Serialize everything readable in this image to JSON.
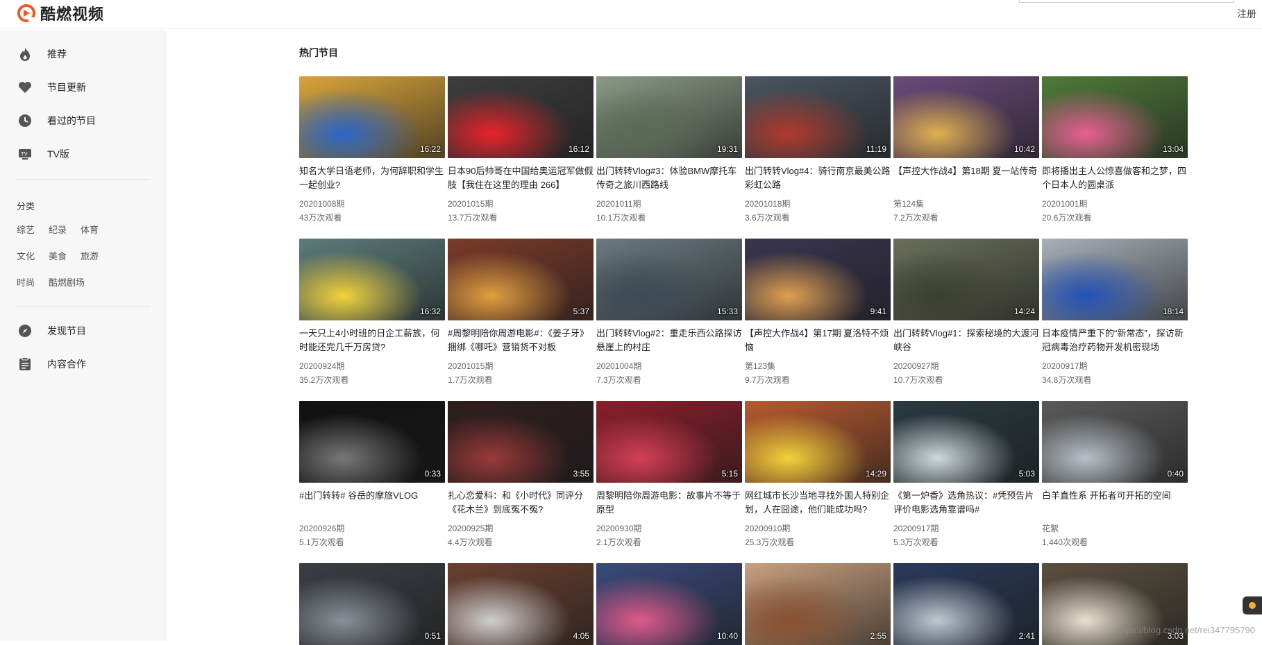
{
  "app": {
    "name": "酷燃视频",
    "register_label": "注册"
  },
  "colors": {
    "brand": "#f05a28"
  },
  "sidebar": {
    "nav_top": [
      {
        "label": "推荐",
        "icon": "flame-icon"
      },
      {
        "label": "节目更新",
        "icon": "heart-icon"
      },
      {
        "label": "看过的节目",
        "icon": "clock-icon"
      },
      {
        "label": "TV版",
        "icon": "tv-icon"
      }
    ],
    "category_title": "分类",
    "categories": [
      [
        "综艺",
        "纪录",
        "体育"
      ],
      [
        "文化",
        "美食",
        "旅游"
      ],
      [
        "时尚",
        "酷燃剧场"
      ]
    ],
    "nav_bottom": [
      {
        "label": "发现节目",
        "icon": "compass-icon"
      },
      {
        "label": "内容合作",
        "icon": "clipboard-icon"
      }
    ]
  },
  "main": {
    "section_title": "热门节目",
    "videos": [
      {
        "title": "知名大学日语老师，为何辞职和学生一起创业?",
        "date": "20201008期",
        "views": "43万次观看",
        "duration": "16:22",
        "bg": "#d9a53b",
        "accent": "#2a66c9"
      },
      {
        "title": "日本90后帅哥在中国给奥运冠军做假肢【我住在这里的理由 266】",
        "date": "20201015期",
        "views": "13.7万次观看",
        "duration": "16:12",
        "bg": "#3d3d3d",
        "accent": "#e8232b"
      },
      {
        "title": "出门转转Vlog#3：体验BMW摩托车传奇之旅川西路线",
        "date": "20201011期",
        "views": "10.1万次观看",
        "duration": "19:31",
        "bg": "#8a9a86",
        "accent": "#5b6a55"
      },
      {
        "title": "出门转转Vlog#4：骑行南京最美公路彩虹公路",
        "date": "20201018期",
        "views": "3.6万次观看",
        "duration": "11:19",
        "bg": "#4a5560",
        "accent": "#b0392c"
      },
      {
        "title": "【声控大作战4】第18期 夏一站传奇",
        "date": "第124集",
        "views": "7.2万次观看",
        "duration": "10:42",
        "bg": "#6a4a7a",
        "accent": "#e0b050"
      },
      {
        "title": "即将播出主人公惊喜做客和之梦，四个日本人的圆桌派",
        "date": "20201001期",
        "views": "20.6万次观看",
        "duration": "13:04",
        "bg": "#4f7a3a",
        "accent": "#e85f94"
      },
      {
        "title": "一天只上4小时班的日企工薪族，何时能还完几千万房贷?",
        "date": "20200924期",
        "views": "35.2万次观看",
        "duration": "16:32",
        "bg": "#5c7c7a",
        "accent": "#f3d33a"
      },
      {
        "title": "#周黎明陪你周游电影#：《姜子牙》捆绑《哪吒》营销货不对板",
        "date": "20201015期",
        "views": "1.7万次观看",
        "duration": "5:37",
        "bg": "#7a3a2a",
        "accent": "#e0a040"
      },
      {
        "title": "出门转转Vlog#2：重走乐西公路探访悬崖上的村庄",
        "date": "20201004期",
        "views": "7.3万次观看",
        "duration": "15:33",
        "bg": "#6a7a80",
        "accent": "#3d4a55"
      },
      {
        "title": "【声控大作战4】第17期 夏洛特不烦恼",
        "date": "第123集",
        "views": "9.7万次观看",
        "duration": "9:41",
        "bg": "#3a3550",
        "accent": "#e0a050"
      },
      {
        "title": "出门转转Vlog#1：探索秘境的大渡河峡谷",
        "date": "20200927期",
        "views": "10.7万次观看",
        "duration": "14:24",
        "bg": "#6a6f5a",
        "accent": "#3c4030"
      },
      {
        "title": "日本疫情严重下的“新常态”，探访新冠病毒治疗药物开发机密现场",
        "date": "20200917期",
        "views": "34.8万次观看",
        "duration": "18:14",
        "bg": "#a8b0b8",
        "accent": "#2452b8"
      },
      {
        "title": "#出门转转# 谷岳的摩旅VLOG",
        "date": "20200926期",
        "views": "5.1万次观看",
        "duration": "0:33",
        "bg": "#111111",
        "accent": "#777777"
      },
      {
        "title": "扎心恋爱科：和《小时代》同评分《花木兰》到底冤不冤?",
        "date": "20200925期",
        "views": "4.4万次观看",
        "duration": "3:55",
        "bg": "#2e1e1e",
        "accent": "#9a3a3a"
      },
      {
        "title": "周黎明陪你周游电影：故事片不等于原型",
        "date": "20200930期",
        "views": "2.1万次观看",
        "duration": "5:15",
        "bg": "#8a1e2a",
        "accent": "#d44055"
      },
      {
        "title": "网红城市长沙当地寻找外国人特别企划，人在囧途，他们能成功吗?",
        "date": "20200910期",
        "views": "25.3万次观看",
        "duration": "14:29",
        "bg": "#b85a30",
        "accent": "#f2d23a"
      },
      {
        "title": "《第一炉香》选角热议：#凭预告片评价电影选角靠谱吗#",
        "date": "20200917期",
        "views": "5.3万次观看",
        "duration": "5:03",
        "bg": "#2a3a40",
        "accent": "#cfd8dc"
      },
      {
        "title": "白羊直性系 开拓者可开拓的空间",
        "date": "花絮",
        "views": "1,440次观看",
        "duration": "0:40",
        "bg": "#5a5a5a",
        "accent": "#b8c0c8"
      },
      {
        "title": "",
        "date": "",
        "views": "",
        "duration": "0:51",
        "bg": "#3a3e44",
        "accent": "#8a9098"
      },
      {
        "title": "",
        "date": "",
        "views": "",
        "duration": "4:05",
        "bg": "#6a4030",
        "accent": "#cfcfcf"
      },
      {
        "title": "",
        "date": "",
        "views": "",
        "duration": "10:40",
        "bg": "#3a4a7a",
        "accent": "#e05a8a"
      },
      {
        "title": "",
        "date": "",
        "views": "",
        "duration": "2:55",
        "bg": "#c8a080",
        "accent": "#8a5030"
      },
      {
        "title": "",
        "date": "",
        "views": "",
        "duration": "2:41",
        "bg": "#2a3a5a",
        "accent": "#c0c8d0"
      },
      {
        "title": "",
        "date": "",
        "views": "",
        "duration": "3:03",
        "bg": "#5a5040",
        "accent": "#e8e0d0"
      }
    ]
  },
  "watermark": "https://blog.csdn.net/rei347795790"
}
